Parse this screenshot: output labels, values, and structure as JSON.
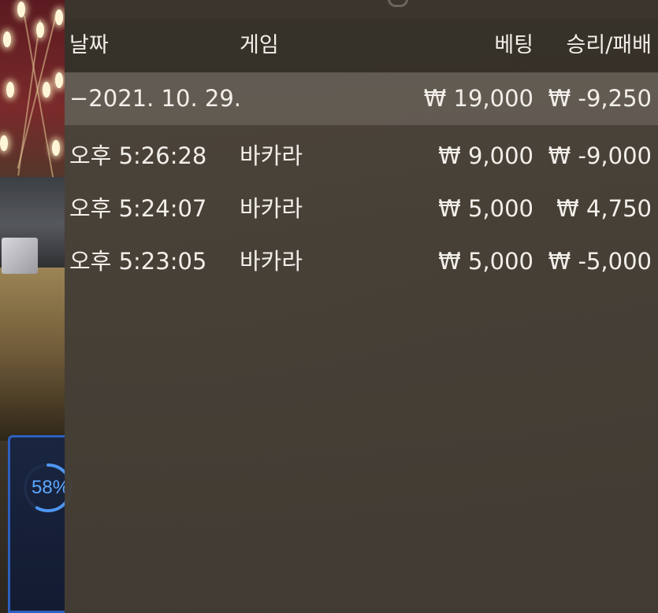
{
  "background": {
    "progress_percent": "58%",
    "progress_value": 0.58
  },
  "history": {
    "headers": {
      "date": "날짜",
      "game": "게임",
      "bet": "베팅",
      "result": "승리/패배"
    },
    "date_group": {
      "date": "−2021. 10. 29.",
      "bet_total": "₩ 19,000",
      "result_total": "₩ -9,250"
    },
    "rows": [
      {
        "time": "오후 5:26:28",
        "game": "바카라",
        "bet": "₩ 9,000",
        "result": "₩ -9,000"
      },
      {
        "time": "오후 5:24:07",
        "game": "바카라",
        "bet": "₩ 5,000",
        "result": "₩ 4,750"
      },
      {
        "time": "오후 5:23:05",
        "game": "바카라",
        "bet": "₩ 5,000",
        "result": "₩ -5,000"
      }
    ]
  },
  "colors": {
    "panel_bg": "#48413a",
    "header_bg": "#2e2923",
    "date_row_bg": "#76706a",
    "text": "#f2efea",
    "progress_accent": "#5ea8ff"
  }
}
